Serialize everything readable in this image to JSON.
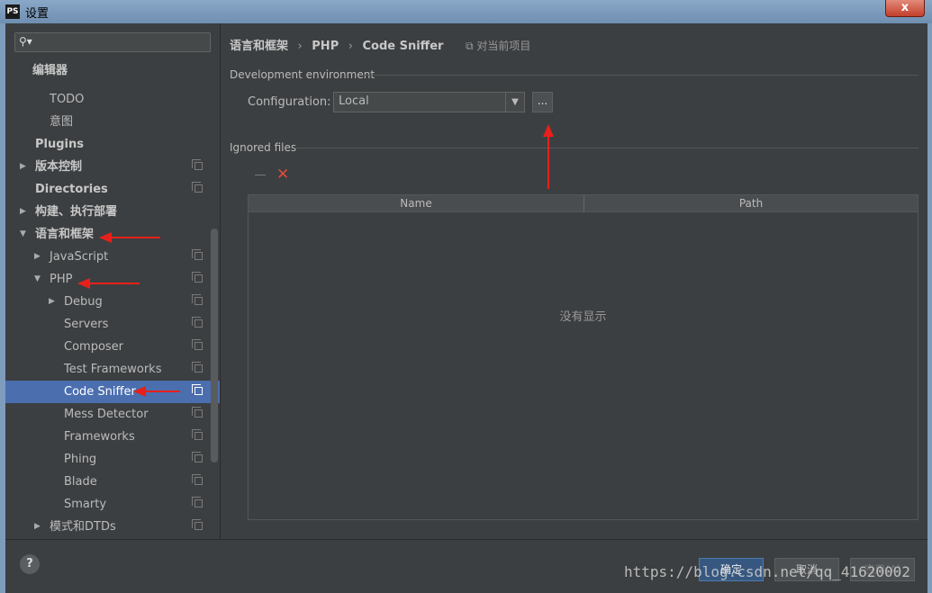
{
  "window": {
    "title": "设置",
    "logo_text": "PS",
    "close_label": "x"
  },
  "sidebar": {
    "items": [
      {
        "label": "编辑器",
        "bold": false
      },
      {
        "label": "TODO"
      },
      {
        "label": "意图"
      },
      {
        "label": "Plugins"
      },
      {
        "label": "版本控制"
      },
      {
        "label": "Directories"
      },
      {
        "label": "构建、执行部署"
      },
      {
        "label": "语言和框架"
      },
      {
        "label": "JavaScript"
      },
      {
        "label": "PHP"
      },
      {
        "label": "Debug"
      },
      {
        "label": "Servers"
      },
      {
        "label": "Composer"
      },
      {
        "label": "Test Frameworks"
      },
      {
        "label": "Code Sniffer"
      },
      {
        "label": "Mess Detector"
      },
      {
        "label": "Frameworks"
      },
      {
        "label": "Phing"
      },
      {
        "label": "Blade"
      },
      {
        "label": "Smarty"
      },
      {
        "label": "模式和DTDs"
      }
    ]
  },
  "breadcrumb": {
    "items": [
      "语言和框架",
      "PHP",
      "Code Sniffer"
    ],
    "project_label": "对当前项目"
  },
  "dev_env": {
    "section_title": "Development environment",
    "config_label": "Configuration:",
    "config_value": "Local",
    "dots_label": "..."
  },
  "ignored": {
    "section_title": "Ignored files",
    "columns": [
      "Name",
      "Path"
    ],
    "empty_text": "没有显示"
  },
  "buttons": {
    "ok": "确定",
    "cancel": "取消",
    "apply": "应用(A)",
    "help": "?"
  },
  "watermark": "https://blog.csdn.net/qq_41620002",
  "colors": {
    "selection": "#4b6eaf",
    "annotation": "#e8201b",
    "background": "#3c3f41"
  }
}
